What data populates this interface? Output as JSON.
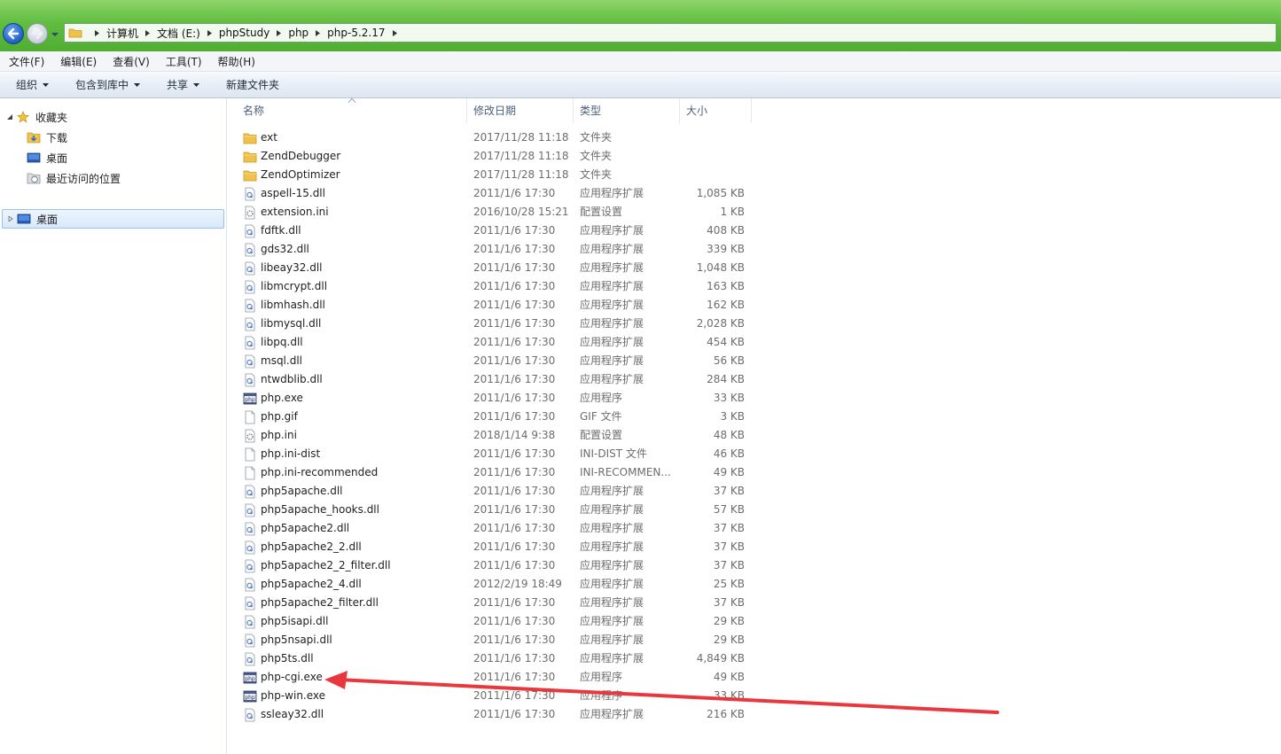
{
  "address": {
    "crumbs": [
      "计算机",
      "文档 (E:)",
      "phpStudy",
      "php",
      "php-5.2.17"
    ]
  },
  "menu": {
    "items": [
      "文件(F)",
      "编辑(E)",
      "查看(V)",
      "工具(T)",
      "帮助(H)"
    ]
  },
  "commands": {
    "organize": "组织",
    "include_library": "包含到库中",
    "share": "共享",
    "new_folder": "新建文件夹"
  },
  "nav": {
    "favorites": "收藏夹",
    "downloads": "下载",
    "desktop": "桌面",
    "recent": "最近访问的位置",
    "desktop_root": "桌面"
  },
  "columns": {
    "name": "名称",
    "date": "修改日期",
    "type": "类型",
    "size": "大小"
  },
  "files": [
    {
      "name": "ext",
      "date": "2017/11/28 11:18",
      "type": "文件夹",
      "size": "",
      "icon": "folder-icon"
    },
    {
      "name": "ZendDebugger",
      "date": "2017/11/28 11:18",
      "type": "文件夹",
      "size": "",
      "icon": "folder-icon"
    },
    {
      "name": "ZendOptimizer",
      "date": "2017/11/28 11:18",
      "type": "文件夹",
      "size": "",
      "icon": "folder-icon"
    },
    {
      "name": "aspell-15.dll",
      "date": "2011/1/6 17:30",
      "type": "应用程序扩展",
      "size": "1,085 KB",
      "icon": "dll-icon"
    },
    {
      "name": "extension.ini",
      "date": "2016/10/28 15:21",
      "type": "配置设置",
      "size": "1 KB",
      "icon": "ini-icon"
    },
    {
      "name": "fdftk.dll",
      "date": "2011/1/6 17:30",
      "type": "应用程序扩展",
      "size": "408 KB",
      "icon": "dll-icon"
    },
    {
      "name": "gds32.dll",
      "date": "2011/1/6 17:30",
      "type": "应用程序扩展",
      "size": "339 KB",
      "icon": "dll-icon"
    },
    {
      "name": "libeay32.dll",
      "date": "2011/1/6 17:30",
      "type": "应用程序扩展",
      "size": "1,048 KB",
      "icon": "dll-icon"
    },
    {
      "name": "libmcrypt.dll",
      "date": "2011/1/6 17:30",
      "type": "应用程序扩展",
      "size": "163 KB",
      "icon": "dll-icon"
    },
    {
      "name": "libmhash.dll",
      "date": "2011/1/6 17:30",
      "type": "应用程序扩展",
      "size": "162 KB",
      "icon": "dll-icon"
    },
    {
      "name": "libmysql.dll",
      "date": "2011/1/6 17:30",
      "type": "应用程序扩展",
      "size": "2,028 KB",
      "icon": "dll-icon"
    },
    {
      "name": "libpq.dll",
      "date": "2011/1/6 17:30",
      "type": "应用程序扩展",
      "size": "454 KB",
      "icon": "dll-icon"
    },
    {
      "name": "msql.dll",
      "date": "2011/1/6 17:30",
      "type": "应用程序扩展",
      "size": "56 KB",
      "icon": "dll-icon"
    },
    {
      "name": "ntwdblib.dll",
      "date": "2011/1/6 17:30",
      "type": "应用程序扩展",
      "size": "284 KB",
      "icon": "dll-icon"
    },
    {
      "name": "php.exe",
      "date": "2011/1/6 17:30",
      "type": "应用程序",
      "size": "33 KB",
      "icon": "php-exe-icon"
    },
    {
      "name": "php.gif",
      "date": "2011/1/6 17:30",
      "type": "GIF 文件",
      "size": "3 KB",
      "icon": "file-icon"
    },
    {
      "name": "php.ini",
      "date": "2018/1/14 9:38",
      "type": "配置设置",
      "size": "48 KB",
      "icon": "ini-icon"
    },
    {
      "name": "php.ini-dist",
      "date": "2011/1/6 17:30",
      "type": "INI-DIST 文件",
      "size": "46 KB",
      "icon": "file-icon"
    },
    {
      "name": "php.ini-recommended",
      "date": "2011/1/6 17:30",
      "type": "INI-RECOMMEN...",
      "size": "49 KB",
      "icon": "file-icon"
    },
    {
      "name": "php5apache.dll",
      "date": "2011/1/6 17:30",
      "type": "应用程序扩展",
      "size": "37 KB",
      "icon": "dll-icon"
    },
    {
      "name": "php5apache_hooks.dll",
      "date": "2011/1/6 17:30",
      "type": "应用程序扩展",
      "size": "57 KB",
      "icon": "dll-icon"
    },
    {
      "name": "php5apache2.dll",
      "date": "2011/1/6 17:30",
      "type": "应用程序扩展",
      "size": "37 KB",
      "icon": "dll-icon"
    },
    {
      "name": "php5apache2_2.dll",
      "date": "2011/1/6 17:30",
      "type": "应用程序扩展",
      "size": "37 KB",
      "icon": "dll-icon"
    },
    {
      "name": "php5apache2_2_filter.dll",
      "date": "2011/1/6 17:30",
      "type": "应用程序扩展",
      "size": "37 KB",
      "icon": "dll-icon"
    },
    {
      "name": "php5apache2_4.dll",
      "date": "2012/2/19 18:49",
      "type": "应用程序扩展",
      "size": "25 KB",
      "icon": "dll-icon"
    },
    {
      "name": "php5apache2_filter.dll",
      "date": "2011/1/6 17:30",
      "type": "应用程序扩展",
      "size": "37 KB",
      "icon": "dll-icon"
    },
    {
      "name": "php5isapi.dll",
      "date": "2011/1/6 17:30",
      "type": "应用程序扩展",
      "size": "29 KB",
      "icon": "dll-icon"
    },
    {
      "name": "php5nsapi.dll",
      "date": "2011/1/6 17:30",
      "type": "应用程序扩展",
      "size": "29 KB",
      "icon": "dll-icon"
    },
    {
      "name": "php5ts.dll",
      "date": "2011/1/6 17:30",
      "type": "应用程序扩展",
      "size": "4,849 KB",
      "icon": "dll-icon"
    },
    {
      "name": "php-cgi.exe",
      "date": "2011/1/6 17:30",
      "type": "应用程序",
      "size": "49 KB",
      "icon": "php-exe-icon"
    },
    {
      "name": "php-win.exe",
      "date": "2011/1/6 17:30",
      "type": "应用程序",
      "size": "33 KB",
      "icon": "php-exe-icon"
    },
    {
      "name": "ssleay32.dll",
      "date": "2011/1/6 17:30",
      "type": "应用程序扩展",
      "size": "216 KB",
      "icon": "dll-icon"
    }
  ],
  "annotation": {
    "color": "#e8383d",
    "points_to": "php-cgi.exe"
  }
}
